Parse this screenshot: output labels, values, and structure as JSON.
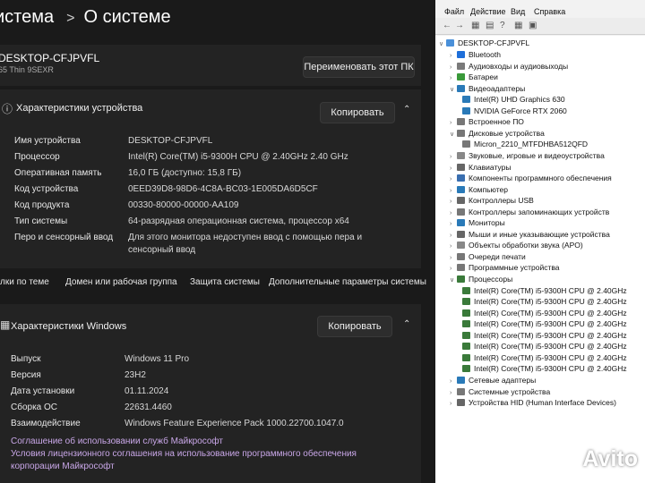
{
  "header": {
    "crumb_parent": "истема",
    "crumb_sep": ">",
    "crumb_current": "О системе"
  },
  "device": {
    "name": "DESKTOP-CFJPVFL",
    "model": "65 Thin 9SEXR",
    "rename_label": "Переименовать этот ПК"
  },
  "device_specs": {
    "title": "Характеристики устройства",
    "copy_label": "Копировать",
    "rows": [
      {
        "label": "Имя устройства",
        "value": "DESKTOP-CFJPVFL"
      },
      {
        "label": "Процессор",
        "value": "Intel(R) Core(TM) i5-9300H CPU @ 2.40GHz   2.40 GHz"
      },
      {
        "label": "Оперативная память",
        "value": "16,0 ГБ (доступно: 15,8 ГБ)"
      },
      {
        "label": "Код устройства",
        "value": "0EED39D8-98D6-4C8A-BC03-1E005DA6D5CF"
      },
      {
        "label": "Код продукта",
        "value": "00330-80000-00000-AA109"
      },
      {
        "label": "Тип системы",
        "value": "64-разрядная операционная система, процессор x64"
      },
      {
        "label": "Перо и сенсорный ввод",
        "value": "Для этого монитора недоступен ввод с помощью пера и",
        "value2": "сенсорный ввод"
      }
    ]
  },
  "links": [
    "лки по теме",
    "Домен или рабочая группа",
    "Защита системы",
    "Дополнительные параметры системы"
  ],
  "windows_specs": {
    "title": "Характеристики Windows",
    "copy_label": "Копировать",
    "rows": [
      {
        "label": "Выпуск",
        "value": "Windows 11 Pro"
      },
      {
        "label": "Версия",
        "value": "23H2"
      },
      {
        "label": "Дата установки",
        "value": "01.11.2024"
      },
      {
        "label": "Сборка ОС",
        "value": "22631.4460"
      },
      {
        "label": "Взаимодействие",
        "value": "Windows Feature Experience Pack 1000.22700.1047.0"
      }
    ],
    "ms_links": [
      "Соглашение об использовании служб Майкрософт",
      "Условия лицензионного соглашения на использование программного обеспечения",
      "корпорации Майкрософт"
    ]
  },
  "devmgr": {
    "menu": [
      "Файл",
      "Действие",
      "Вид",
      "Справка"
    ],
    "root": "DESKTOP-CFJPVFL",
    "nodes": [
      {
        "label": "Bluetooth",
        "indent": 1,
        "expanded": false,
        "color": "#1e6fd9"
      },
      {
        "label": "Аудиовходы и аудиовыходы",
        "indent": 1,
        "expanded": false,
        "color": "#7a7a7a"
      },
      {
        "label": "Батареи",
        "indent": 1,
        "expanded": false,
        "color": "#3a9a3a"
      },
      {
        "label": "Видеоадаптеры",
        "indent": 1,
        "expanded": true,
        "color": "#2a7ab8"
      },
      {
        "label": "Intel(R) UHD Graphics 630",
        "indent": 2,
        "color": "#2a7ab8"
      },
      {
        "label": "NVIDIA GeForce RTX 2060",
        "indent": 2,
        "color": "#2a7ab8"
      },
      {
        "label": "Встроенное ПО",
        "indent": 1,
        "expanded": false,
        "color": "#777"
      },
      {
        "label": "Дисковые устройства",
        "indent": 1,
        "expanded": true,
        "color": "#777"
      },
      {
        "label": "Micron_2210_MTFDHBA512QFD",
        "indent": 2,
        "color": "#777"
      },
      {
        "label": "Звуковые, игровые и видеоустройства",
        "indent": 1,
        "expanded": false,
        "color": "#888"
      },
      {
        "label": "Клавиатуры",
        "indent": 1,
        "expanded": false,
        "color": "#666"
      },
      {
        "label": "Компоненты программного обеспечения",
        "indent": 1,
        "expanded": false,
        "color": "#3a6fb0"
      },
      {
        "label": "Компьютер",
        "indent": 1,
        "expanded": false,
        "color": "#2a7ab8"
      },
      {
        "label": "Контроллеры USB",
        "indent": 1,
        "expanded": false,
        "color": "#666"
      },
      {
        "label": "Контроллеры запоминающих устройств",
        "indent": 1,
        "expanded": false,
        "color": "#777"
      },
      {
        "label": "Мониторы",
        "indent": 1,
        "expanded": false,
        "color": "#2a7ab8"
      },
      {
        "label": "Мыши и иные указывающие устройства",
        "indent": 1,
        "expanded": false,
        "color": "#666"
      },
      {
        "label": "Объекты обработки звука (APO)",
        "indent": 1,
        "expanded": false,
        "color": "#888"
      },
      {
        "label": "Очереди печати",
        "indent": 1,
        "expanded": false,
        "color": "#777"
      },
      {
        "label": "Программные устройства",
        "indent": 1,
        "expanded": false,
        "color": "#777"
      },
      {
        "label": "Процессоры",
        "indent": 1,
        "expanded": true,
        "color": "#3a7a3a"
      },
      {
        "label": "Intel(R) Core(TM) i5-9300H CPU @ 2.40GHz",
        "indent": 2,
        "color": "#3a7a3a"
      },
      {
        "label": "Intel(R) Core(TM) i5-9300H CPU @ 2.40GHz",
        "indent": 2,
        "color": "#3a7a3a"
      },
      {
        "label": "Intel(R) Core(TM) i5-9300H CPU @ 2.40GHz",
        "indent": 2,
        "color": "#3a7a3a"
      },
      {
        "label": "Intel(R) Core(TM) i5-9300H CPU @ 2.40GHz",
        "indent": 2,
        "color": "#3a7a3a"
      },
      {
        "label": "Intel(R) Core(TM) i5-9300H CPU @ 2.40GHz",
        "indent": 2,
        "color": "#3a7a3a"
      },
      {
        "label": "Intel(R) Core(TM) i5-9300H CPU @ 2.40GHz",
        "indent": 2,
        "color": "#3a7a3a"
      },
      {
        "label": "Intel(R) Core(TM) i5-9300H CPU @ 2.40GHz",
        "indent": 2,
        "color": "#3a7a3a"
      },
      {
        "label": "Intel(R) Core(TM) i5-9300H CPU @ 2.40GHz",
        "indent": 2,
        "color": "#3a7a3a"
      },
      {
        "label": "Сетевые адаптеры",
        "indent": 1,
        "expanded": false,
        "color": "#2a7ab8"
      },
      {
        "label": "Системные устройства",
        "indent": 1,
        "expanded": false,
        "color": "#777"
      },
      {
        "label": "Устройства HID (Human Interface Devices)",
        "indent": 1,
        "expanded": false,
        "color": "#666"
      }
    ]
  },
  "watermark": "Avito"
}
